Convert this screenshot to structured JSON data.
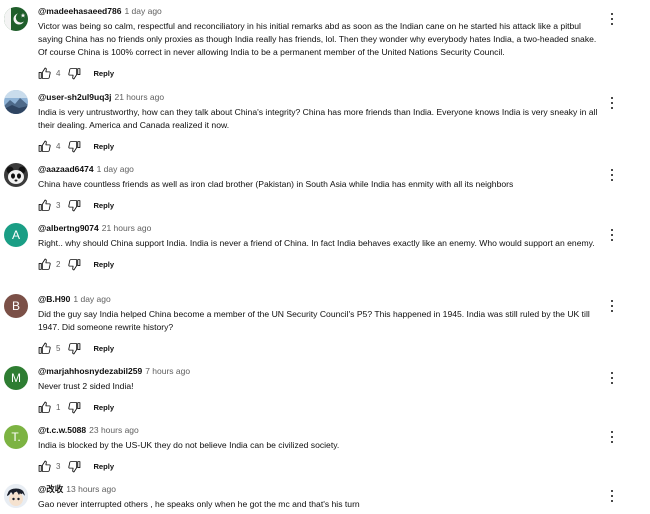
{
  "comments": [
    {
      "author": "@madeehasaeed786",
      "time": "1 day ago",
      "text": "Victor was being so calm, respectful and reconciliatory in his initial remarks abd as soon as the Indian cane on he started his attack like a pitbul saying China has no friends only proxies as though India really has friends, lol. Then they wonder why everybody hates India, a two-headed snake. Of course China is 100% correct in never allowing India to be a permanent member of the United Nations Security Council.",
      "likes": "4",
      "reply_label": "Reply",
      "avatar": {
        "type": "image",
        "icon": "flag-avatar-icon"
      }
    },
    {
      "author": "@user-sh2ul9uq3j",
      "time": "21 hours ago",
      "text": "India is very untrustworthy, how can they talk about China's integrity? China has more friends than India. Everyone knows India is very sneaky in all their dealing. America and Canada realized it now.",
      "likes": "4",
      "reply_label": "Reply",
      "avatar": {
        "type": "image",
        "icon": "landscape-avatar-icon"
      }
    },
    {
      "author": "@aazaad6474",
      "time": "1 day ago",
      "text": "China have countless friends as well as iron clad brother (Pakistan) in South Asia while India has enmity with all its neighbors",
      "likes": "3",
      "reply_label": "Reply",
      "avatar": {
        "type": "image",
        "icon": "panda-avatar-icon"
      }
    },
    {
      "author": "@albertng9074",
      "time": "21 hours ago",
      "text": "Right.. why should China support India. India is never a friend of China. In fact India behaves exactly like an enemy. Who would support an enemy.",
      "likes": "2",
      "reply_label": "Reply",
      "avatar": {
        "type": "letter",
        "letter": "A",
        "color": "#1a9e85"
      }
    },
    {
      "author": "@B.H90",
      "time": "1 day ago",
      "text": "Did the guy say India helped China become a member of the UN Security Council's P5? This happened in 1945. India was still ruled by the UK till 1947.   Did someone rewrite history?",
      "likes": "5",
      "reply_label": "Reply",
      "avatar": {
        "type": "letter",
        "letter": "B",
        "color": "#7b5047"
      }
    },
    {
      "author": "@marjahhosnydezabil259",
      "time": "7 hours ago",
      "text": "Never trust 2 sided India!",
      "likes": "1",
      "reply_label": "Reply",
      "avatar": {
        "type": "letter",
        "letter": "M",
        "color": "#2e7d32"
      }
    },
    {
      "author": "@t.c.w.5088",
      "time": "23 hours ago",
      "text": "India is blocked by the US-UK they do not believe India can be civilized society.",
      "likes": "3",
      "reply_label": "Reply",
      "avatar": {
        "type": "letter",
        "letter": "T.",
        "color": "#7cb342"
      }
    },
    {
      "author": "@改收",
      "time": "13 hours ago",
      "text": "Gao never interrupted others , he speaks only when he got the mc and that's his turn",
      "likes": "",
      "reply_label": "",
      "avatar": {
        "type": "image",
        "icon": "cartoon-avatar-icon"
      }
    }
  ],
  "icons": {
    "like": "thumbs-up-icon",
    "dislike": "thumbs-down-icon",
    "menu": "more-vertical-icon"
  }
}
